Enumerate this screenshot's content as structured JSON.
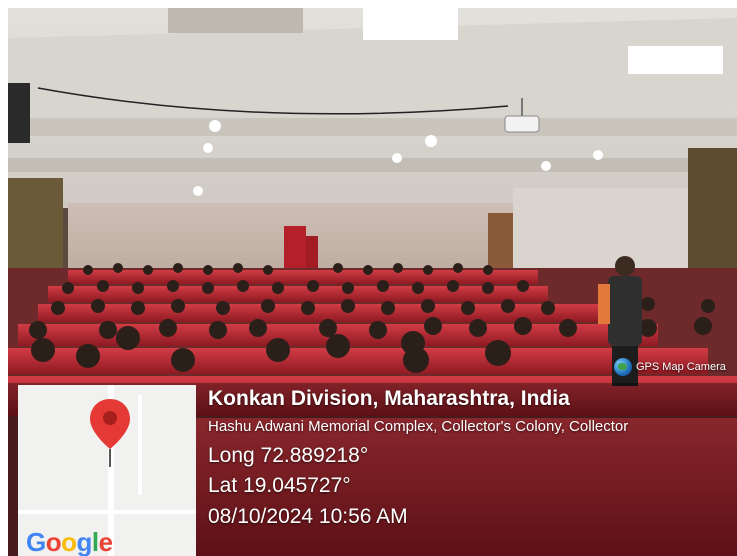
{
  "photo": {
    "description_colors": {
      "seat": "#b4202a",
      "ceiling": "#e8e6e2",
      "wall": "#cbb9ae",
      "curtain": "#6b5a38"
    }
  },
  "badge": {
    "label": "GPS Map Camera",
    "icon": "globe-icon"
  },
  "map": {
    "logo": [
      "G",
      "o",
      "o",
      "g",
      "l",
      "e"
    ],
    "pin_icon": "location-pin-icon",
    "pin_color": "#e53935"
  },
  "location": {
    "title": "Konkan Division, Maharashtra, India",
    "address": "Hashu Adwani Memorial Complex, Collector's Colony, Collector",
    "longitude": "Long 72.889218°",
    "latitude": "Lat 19.045727°",
    "datetime": "08/10/2024 10:56 AM"
  }
}
